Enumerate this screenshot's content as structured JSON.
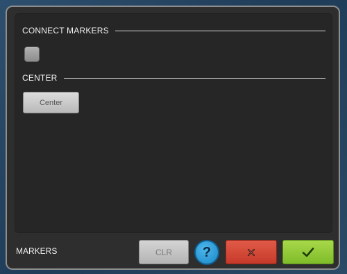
{
  "sections": {
    "connect_markers": {
      "title": "CONNECT MARKERS",
      "checked": false
    },
    "center": {
      "title": "CENTER",
      "button_label": "Center"
    }
  },
  "footer": {
    "label": "MARKERS",
    "clr_label": "CLR",
    "help_label": "?",
    "cancel_icon": "x-icon",
    "ok_icon": "check-icon"
  },
  "colors": {
    "cancel": "#c63a2a",
    "ok": "#7fbc2a",
    "help": "#1a86c6"
  }
}
